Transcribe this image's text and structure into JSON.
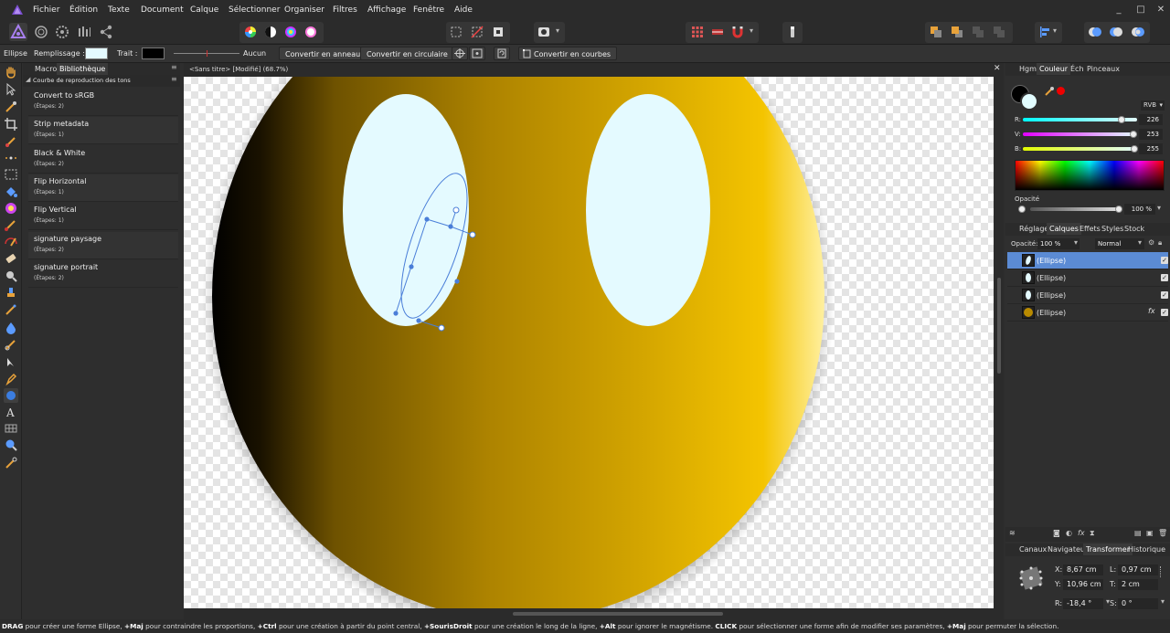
{
  "menu": [
    "Fichier",
    "Édition",
    "Texte",
    "Document",
    "Calque",
    "Sélectionner",
    "Organiser",
    "Filtres",
    "Affichage",
    "Fenêtre",
    "Aide"
  ],
  "context": {
    "tool_name": "Ellipse",
    "fill_label": "Remplissage :",
    "stroke_label": "Trait :",
    "stroke_style": "Aucun",
    "convert_ring": "Convertir en anneau",
    "convert_circular": "Convertir en circulaire",
    "convert_curves": "Convertir en courbes",
    "fill_color": "#e4faff",
    "stroke_color": "#000000"
  },
  "left_panel": {
    "tabs": [
      "Macro",
      "Bibliothèque"
    ],
    "category": "Courbe de reproduction des tons",
    "macros": [
      {
        "name": "Convert to sRGB",
        "steps": "(Étapes: 2)"
      },
      {
        "name": "Strip metadata",
        "steps": "(Étapes: 1)"
      },
      {
        "name": "Black & White",
        "steps": "(Étapes: 2)"
      },
      {
        "name": "Flip Horizontal",
        "steps": "(Étapes: 1)"
      },
      {
        "name": "Flip Vertical",
        "steps": "(Étapes: 1)"
      },
      {
        "name": "signature paysage",
        "steps": "(Étapes: 2)"
      },
      {
        "name": "signature portrait",
        "steps": "(Étapes: 2)"
      }
    ]
  },
  "document": {
    "title": "<Sans titre> [Modifié] (68.7%)"
  },
  "color_panel": {
    "tabs": [
      "Hgm",
      "Couleur",
      "Éch",
      "Pinceaux"
    ],
    "mode": "RVB",
    "r_label": "R:",
    "r": "226",
    "r_frac": 0.886,
    "g_label": "V:",
    "g": "253",
    "g_frac": 0.992,
    "b_label": "B:",
    "b": "255",
    "b_frac": 1.0,
    "opacity_label": "Opacité",
    "opacity": "100 %",
    "current_color": "#e2fdff"
  },
  "layers_panel": {
    "tabs": [
      "Réglage",
      "Calques",
      "Effets",
      "Styles",
      "Stock"
    ],
    "opacity_label": "Opacité:",
    "opacity": "100 %",
    "blend_mode": "Normal",
    "layers": [
      {
        "name": "(Ellipse)",
        "selected": true,
        "fx": false
      },
      {
        "name": "(Ellipse)",
        "selected": false,
        "fx": false
      },
      {
        "name": "(Ellipse)",
        "selected": false,
        "fx": false
      },
      {
        "name": "(Ellipse)",
        "selected": false,
        "fx": true
      }
    ],
    "fx_label": "fx"
  },
  "transform_panel": {
    "tabs": [
      "Canaux",
      "Navigateur",
      "Transformer",
      "Historique"
    ],
    "x_label": "X:",
    "x": "8,67 cm",
    "y_label": "Y:",
    "y": "10,96 cm",
    "w_label": "L:",
    "w": "0,97 cm",
    "h_label": "T:",
    "h": "2 cm",
    "r_label": "R:",
    "r": "-18,4 °",
    "s_label": "S:",
    "s": "0 °"
  },
  "status": {
    "parts": [
      {
        "b": "DRAG",
        "t": " pour créer une forme Ellipse, "
      },
      {
        "b": "+Maj",
        "t": " pour contraindre les proportions, "
      },
      {
        "b": "+Ctrl",
        "t": " pour une création à partir du point central, "
      },
      {
        "b": "+SourisDroit",
        "t": " pour une création le long de la ligne, "
      },
      {
        "b": "+Alt",
        "t": " pour ignorer le magnétisme. "
      },
      {
        "b": "CLICK",
        "t": " pour sélectionner une forme afin de modifier ses paramètres, "
      },
      {
        "b": "+Maj",
        "t": " pour permuter la sélection."
      }
    ]
  },
  "window_controls": [
    "_",
    "□",
    "✕"
  ]
}
